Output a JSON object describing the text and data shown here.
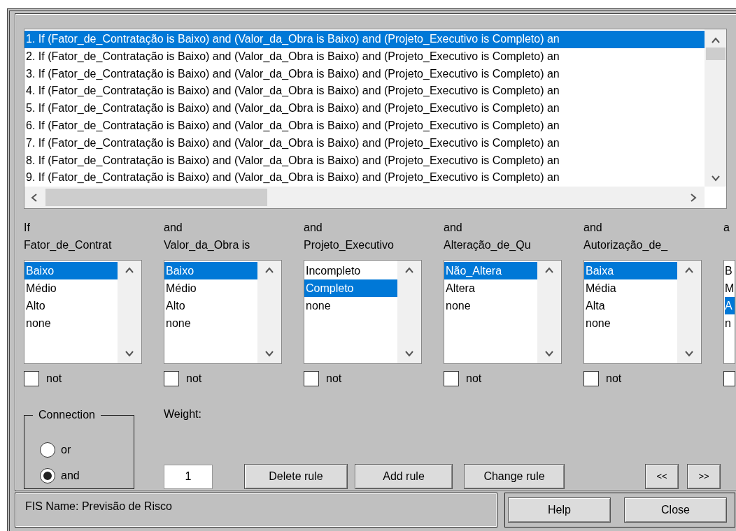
{
  "rules": [
    {
      "text": "1. If (Fator_de_Contratação is Baixo) and (Valor_da_Obra is Baixo) and (Projeto_Executivo is Completo) an",
      "selected": true
    },
    {
      "text": "2. If (Fator_de_Contratação is Baixo) and (Valor_da_Obra is Baixo) and (Projeto_Executivo is Completo) an",
      "selected": false
    },
    {
      "text": "3. If (Fator_de_Contratação is Baixo) and (Valor_da_Obra is Baixo) and (Projeto_Executivo is Completo) an",
      "selected": false
    },
    {
      "text": "4. If (Fator_de_Contratação is Baixo) and (Valor_da_Obra is Baixo) and (Projeto_Executivo is Completo) an",
      "selected": false
    },
    {
      "text": "5. If (Fator_de_Contratação is Baixo) and (Valor_da_Obra is Baixo) and (Projeto_Executivo is Completo) an",
      "selected": false
    },
    {
      "text": "6. If (Fator_de_Contratação is Baixo) and (Valor_da_Obra is Baixo) and (Projeto_Executivo is Completo) an",
      "selected": false
    },
    {
      "text": "7. If (Fator_de_Contratação is Baixo) and (Valor_da_Obra is Baixo) and (Projeto_Executivo is Completo) an",
      "selected": false
    },
    {
      "text": "8. If (Fator_de_Contratação is Baixo) and (Valor_da_Obra is Baixo) and (Projeto_Executivo is Completo) an",
      "selected": false
    },
    {
      "text": "9. If (Fator_de_Contratação is Baixo) and (Valor_da_Obra is Baixo) and (Projeto_Executivo is Completo) an",
      "selected": false
    }
  ],
  "antecedents": [
    {
      "connector": "If",
      "variable": "Fator_de_Contrat",
      "options": [
        {
          "label": "Baixo",
          "selected": true
        },
        {
          "label": "Médio",
          "selected": false
        },
        {
          "label": "Alto",
          "selected": false
        },
        {
          "label": "none",
          "selected": false
        }
      ],
      "not": false,
      "not_label": "not"
    },
    {
      "connector": "and",
      "variable": "Valor_da_Obra is",
      "options": [
        {
          "label": "Baixo",
          "selected": true
        },
        {
          "label": "Médio",
          "selected": false
        },
        {
          "label": "Alto",
          "selected": false
        },
        {
          "label": "none",
          "selected": false
        }
      ],
      "not": false,
      "not_label": "not"
    },
    {
      "connector": "and",
      "variable": "Projeto_Executivo",
      "options": [
        {
          "label": "Incompleto",
          "selected": false
        },
        {
          "label": "Completo",
          "selected": true
        },
        {
          "label": "none",
          "selected": false
        }
      ],
      "not": false,
      "not_label": "not"
    },
    {
      "connector": "and",
      "variable": "Alteração_de_Qu",
      "options": [
        {
          "label": "Não_Altera",
          "selected": true
        },
        {
          "label": "Altera",
          "selected": false
        },
        {
          "label": "none",
          "selected": false
        }
      ],
      "not": false,
      "not_label": "not"
    },
    {
      "connector": "and",
      "variable": "Autorização_de_",
      "options": [
        {
          "label": "Baixa",
          "selected": true
        },
        {
          "label": "Média",
          "selected": false
        },
        {
          "label": "Alta",
          "selected": false
        },
        {
          "label": "none",
          "selected": false
        }
      ],
      "not": false,
      "not_label": "not"
    },
    {
      "connector": "a",
      "options": [
        {
          "label": "B",
          "selected": false
        },
        {
          "label": "M",
          "selected": false
        },
        {
          "label": "A",
          "selected": true
        },
        {
          "label": "n",
          "selected": false
        }
      ],
      "not": false
    }
  ],
  "connection": {
    "title": "Connection",
    "options": [
      {
        "label": "or",
        "selected": false
      },
      {
        "label": "and",
        "selected": true
      }
    ]
  },
  "weight": {
    "label": "Weight:",
    "value": "1"
  },
  "rule_buttons": [
    "Delete rule",
    "Add rule",
    "Change rule"
  ],
  "nav_buttons": [
    "<<",
    ">>"
  ],
  "status": "FIS Name: Previsão de Risco",
  "footer_buttons": [
    "Help",
    "Close"
  ]
}
